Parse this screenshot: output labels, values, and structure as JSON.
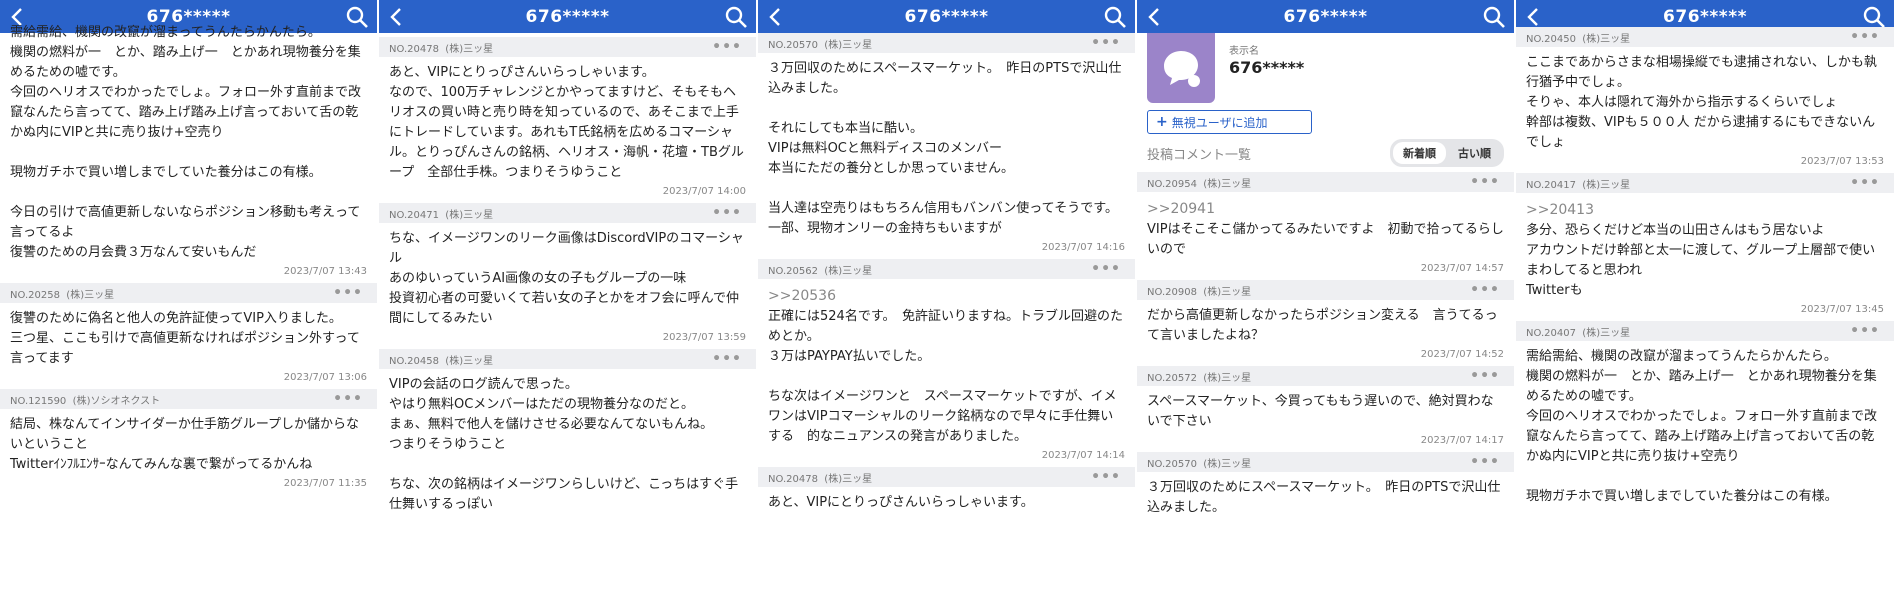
{
  "header": {
    "title": "676*****"
  },
  "panels": [
    {
      "comments": [
        {
          "text": "需給需給、機関の改竄が溜まってうんたらかんたら。\n機関の燃料が一　とか、踏み上げ一　とかあれ現物養分を集めるための嘘です。\n今回のヘリオスでわかったでしょ。フォロー外す直前まで改竄なんたら言ってて、踏み上げ踏み上げ言っておいて舌の乾かぬ内にVIPと共に売り抜け+空売り\n\n現物ガチホで買い増しまでしていた養分はこの有様。\n\n今日の引けで高値更新しないならポジション移動も考えって言ってるよ\n復讐のための月会費３万なんて安いもんだ",
          "time": "2023/7/07 13:43"
        },
        {
          "no": "NO.20258",
          "author": "(株)三ッ星",
          "text": "復讐のために偽名と他人の免許証使ってVIP入りました。\n三つ星、ここも引けで高値更新なければポジション外すって言ってます",
          "time": "2023/7/07 13:06"
        },
        {
          "no": "NO.121590",
          "author": "(株)ソシオネクスト",
          "text": "結局、株なんてインサイダーか仕手筋グループしか儲からないということ\nTwitterｲﾝﾌﾙｴﾝｻｰなんてみんな裏で繋がってるかんね",
          "time": "2023/7/07 11:35"
        }
      ]
    },
    {
      "comments": [
        {
          "no": "NO.20478",
          "author": "(株)三ッ星",
          "text": "あと、VIPにとりっぴさんいらっしゃいます。\nなので、100万チャレンジとかやってますけど、そもそもヘリオスの買い時と売り時を知っているので、あそこまで上手にトレードしています。あれもT氏銘柄を広めるコマーシャル。とりっぴんさんの銘柄、ヘリオス・海帆・花壇・TBグループ　全部仕手株。つまりそうゆうこと",
          "time": "2023/7/07 14:00"
        },
        {
          "no": "NO.20471",
          "author": "(株)三ッ星",
          "text": "ちな、イメージワンのリーク画像はDiscordVIPのコマーシャル\nあのゆいっていうAI画像の女の子もグループの一味\n投資初心者の可愛いくて若い女の子とかをオフ会に呼んで仲間にしてるみたい",
          "time": "2023/7/07 13:59"
        },
        {
          "no": "NO.20458",
          "author": "(株)三ッ星",
          "text": "VIPの会話のログ読んで思った。\nやはり無料OCメンバーはただの現物養分なのだと。\nまぁ、無料で他人を儲けさせる必要なんてないもんね。\nつまりそうゆうこと\n\nちな、次の銘柄はイメージワンらしいけど、こっちはすぐ手仕舞いするっぽい"
        }
      ]
    },
    {
      "comments": [
        {
          "no": "NO.20570",
          "author": "(株)三ッ星",
          "text": "３万回収のためにスペースマーケット。　昨日のPTSで沢山仕込みました。\n\nそれにしても本当に酷い。\nVIPは無料OCと無料ディスコのメンバー\n本当にただの養分としか思っていません。\n\n当人達は空売りはもちろん信用もバンバン使ってそうです。\n一部、現物オンリーの金持ちもいますが",
          "time": "2023/7/07 14:16"
        },
        {
          "no": "NO.20562",
          "author": "(株)三ッ星",
          "reply": ">>20536",
          "text": "正確には524名です。　免許証いりますね。トラブル回避のためとか。\n３万はPAYPAY払いでした。\n\nちな次はイメージワンと　スペースマーケットですが、イメワンはVIPコマーシャルのリーク銘柄なので早々に手仕舞いする　的なニュアンスの発言がありました。",
          "time": "2023/7/07 14:14"
        },
        {
          "no": "NO.20478",
          "author": "(株)三ッ星",
          "text": "あと、VIPにとりっぴさんいらっしゃいます。"
        }
      ]
    },
    {
      "profile": {
        "display_label": "表示名",
        "display_name": "676*****",
        "add_ignore_label": "無視ユーザに追加",
        "list_label": "投稿コメント一覧",
        "sort_new": "新着順",
        "sort_old": "古い順"
      },
      "comments": [
        {
          "no": "NO.20954",
          "author": "(株)三ッ星",
          "reply": ">>20941",
          "text": "VIPはそこそこ儲かってるみたいですよ　初動で拾ってるらしいので",
          "time": "2023/7/07 14:57"
        },
        {
          "no": "NO.20908",
          "author": "(株)三ッ星",
          "text": "だから高値更新しなかったらポジション変える　言うてるって言いましたよね？",
          "time": "2023/7/07 14:52"
        },
        {
          "no": "NO.20572",
          "author": "(株)三ッ星",
          "text": "スペースマーケット、今買ってももう遅いので、絶対買わないで下さい",
          "time": "2023/7/07 14:17"
        },
        {
          "no": "NO.20570",
          "author": "(株)三ッ星",
          "text": "３万回収のためにスペースマーケット。　昨日のPTSで沢山仕込みました。"
        }
      ]
    },
    {
      "comments": [
        {
          "no": "NO.20450",
          "author": "(株)三ッ星",
          "text": "ここまであからさまな相場操縦でも逮捕されない、しかも執行猶予中でしょ。\nそりゃ、本人は隠れて海外から指示するくらいでしょ\n幹部は複数、VIPも５００人 だから逮捕するにもできないんでしょ",
          "time": "2023/7/07 13:53"
        },
        {
          "no": "NO.20417",
          "author": "(株)三ッ星",
          "reply": ">>20413",
          "text": "多分、恐らくだけど本当の山田さんはもう居ないよ\nアカウントだけ幹部と太一に渡して、グループ上層部で使いまわしてると思われ\nTwitterも",
          "time": "2023/7/07 13:45"
        },
        {
          "no": "NO.20407",
          "author": "(株)三ッ星",
          "text": "需給需給、機関の改竄が溜まってうんたらかんたら。\n機関の燃料が一　とか、踏み上げ一　とかあれ現物養分を集めるための嘘です。\n今回のヘリオスでわかったでしょ。フォロー外す直前まで改竄なんたら言ってて、踏み上げ踏み上げ言っておいて舌の乾かぬ内にVIPと共に売り抜け+空売り\n\n現物ガチホで買い増しまでしていた養分はこの有様。"
        }
      ]
    }
  ],
  "icons": {
    "back": "chevron-left-icon",
    "search": "search-icon",
    "more": "more-dots-icon",
    "plus": "plus-icon",
    "avatar": "speech-bubble-icon"
  },
  "colors": {
    "header": "#2a62c9",
    "meta_bg": "#eeeff2",
    "avatar": "#9b84c9"
  }
}
